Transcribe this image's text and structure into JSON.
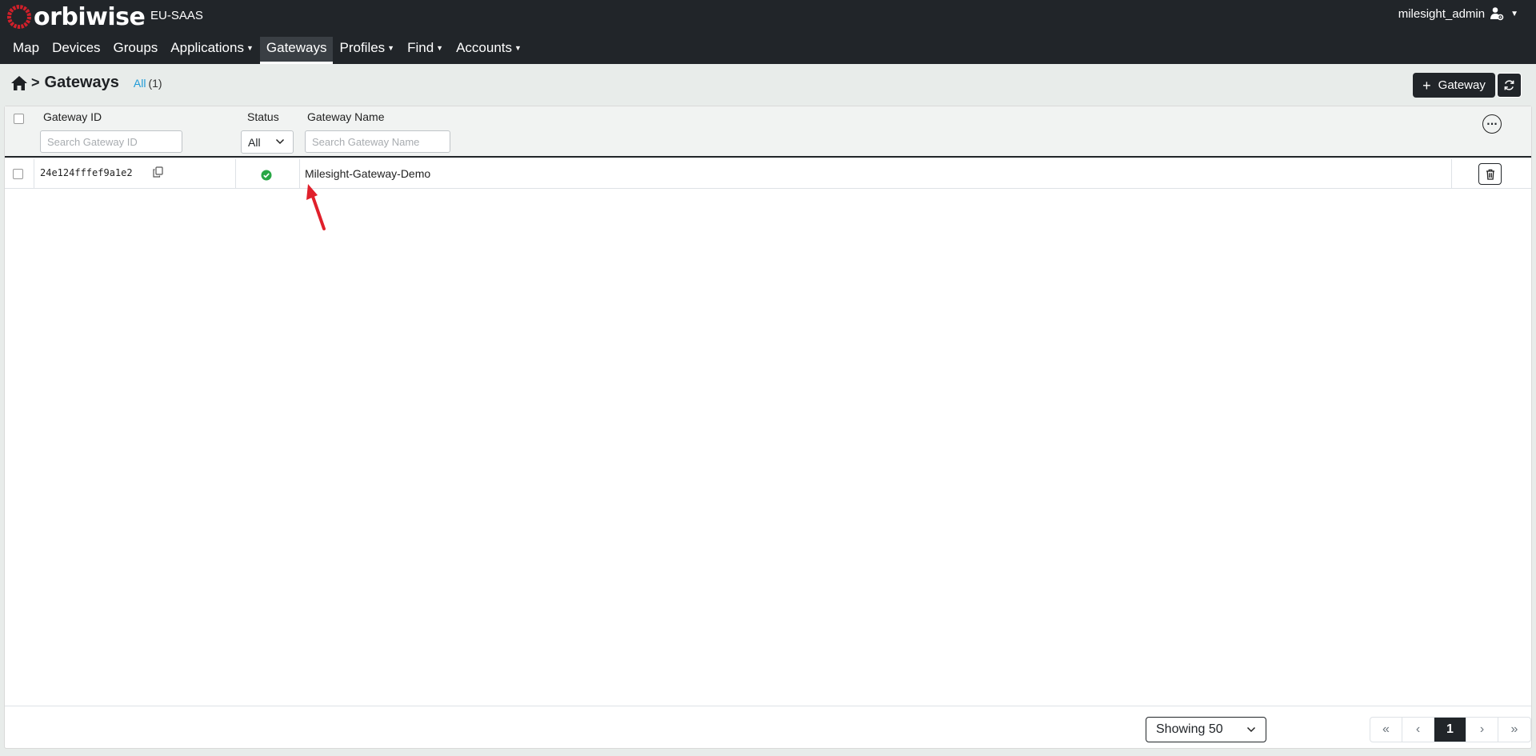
{
  "app": {
    "brand": "orbiwise",
    "environment": "EU-SAAS",
    "user": "milesight_admin"
  },
  "nav": [
    {
      "label": "Map",
      "dropdown": false
    },
    {
      "label": "Devices",
      "dropdown": false
    },
    {
      "label": "Groups",
      "dropdown": false
    },
    {
      "label": "Applications",
      "dropdown": true
    },
    {
      "label": "Gateways",
      "dropdown": false,
      "active": true
    },
    {
      "label": "Profiles",
      "dropdown": true
    },
    {
      "label": "Find",
      "dropdown": true
    },
    {
      "label": "Accounts",
      "dropdown": true
    }
  ],
  "breadcrumb": {
    "separator": ">",
    "title": "Gateways",
    "filter_label": "All",
    "filter_count": "(1)"
  },
  "actions": {
    "add_label": "Gateway",
    "add_icon": "plus-icon",
    "refresh_icon": "refresh-icon"
  },
  "table": {
    "columns": {
      "gateway_id": "Gateway ID",
      "status": "Status",
      "gateway_name": "Gateway Name"
    },
    "filters": {
      "gateway_id_placeholder": "Search Gateway ID",
      "status_value": "All",
      "gateway_name_placeholder": "Search Gateway Name"
    },
    "rows": [
      {
        "gateway_id": "24e124fffef9a1e2",
        "status": "online",
        "status_color": "#28a745",
        "gateway_name": "Milesight-Gateway-Demo"
      }
    ]
  },
  "footer": {
    "page_size": "Showing 50",
    "pager": {
      "first": "«",
      "prev": "‹",
      "current": "1",
      "next": "›",
      "last": "»"
    }
  },
  "colors": {
    "navbar": "#212529",
    "accent_link": "#1f9bd7",
    "annotation_arrow": "#e0202b"
  }
}
